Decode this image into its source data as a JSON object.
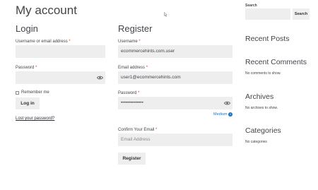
{
  "page": {
    "title": "My account"
  },
  "login": {
    "title": "Login",
    "username_label": "Username or email address",
    "username_value": "",
    "password_label": "Password",
    "password_value": "",
    "remember_label": "Remember me",
    "login_button": "Log in",
    "lost_password_link": "Lost your password?"
  },
  "register": {
    "title": "Register",
    "username_label": "Username",
    "username_value": "ecommercehints.com.user",
    "email_label": "Email address",
    "email_value": "user1@ecommercehints.com",
    "password_label": "Password",
    "password_value": "••••••••••••••",
    "strength_label": "Medium",
    "strength_icon": "info-icon",
    "confirm_email_label": "Confirm Your Email",
    "confirm_email_placeholder": "Email Address",
    "register_button": "Register"
  },
  "required_marker": "*",
  "sidebar": {
    "search_label": "Search",
    "search_value": "",
    "search_button": "Search",
    "recent_posts_title": "Recent Posts",
    "recent_comments_title": "Recent Comments",
    "recent_comments_text": "No comments to show.",
    "archives_title": "Archives",
    "archives_text": "No archives to show.",
    "categories_title": "Categories",
    "categories_text": "No categories"
  },
  "colors": {
    "accent": "#1e73be",
    "required": "#e2401c",
    "field_bg": "#eeeeee",
    "heading": "#43454b"
  }
}
